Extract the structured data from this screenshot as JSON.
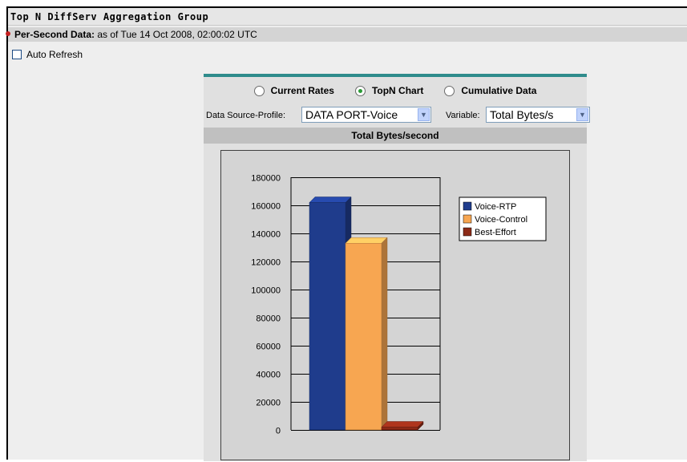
{
  "page": {
    "title": "Top N DiffServ Aggregation Group",
    "subtitle_label": "Per-Second Data:",
    "subtitle_value": " as of Tue 14 Oct 2008, 02:00:02 UTC",
    "auto_refresh_label": "Auto Refresh",
    "auto_refresh_checked": false
  },
  "view_options": [
    {
      "label": "Current Rates",
      "selected": false
    },
    {
      "label": "TopN Chart",
      "selected": true
    },
    {
      "label": "Cumulative Data",
      "selected": false
    }
  ],
  "filters": {
    "data_source_label": "Data Source-Profile:",
    "data_source_value": "DATA PORT-Voice",
    "variable_label": "Variable:",
    "variable_value": "Total Bytes/s"
  },
  "colors": {
    "accent": "#2f8c8c",
    "voice_rtp": "#1f3c8c",
    "voice_control": "#f7a651",
    "best_effort": "#8c2a17"
  },
  "chart_data": {
    "type": "bar",
    "title": "Total Bytes/second",
    "categories": [
      "Voice-RTP",
      "Voice-Control",
      "Best-Effort"
    ],
    "values": [
      162000,
      133000,
      2000
    ],
    "ylim": [
      0,
      180000
    ],
    "yticks": [
      0,
      20000,
      40000,
      60000,
      80000,
      100000,
      120000,
      140000,
      160000,
      180000
    ],
    "grid": true,
    "three_d": true,
    "legend": [
      {
        "name": "Voice-RTP",
        "color": "#1f3c8c"
      },
      {
        "name": "Voice-Control",
        "color": "#f7a651"
      },
      {
        "name": "Best-Effort",
        "color": "#8c2a17"
      }
    ],
    "legend_position": "right"
  }
}
